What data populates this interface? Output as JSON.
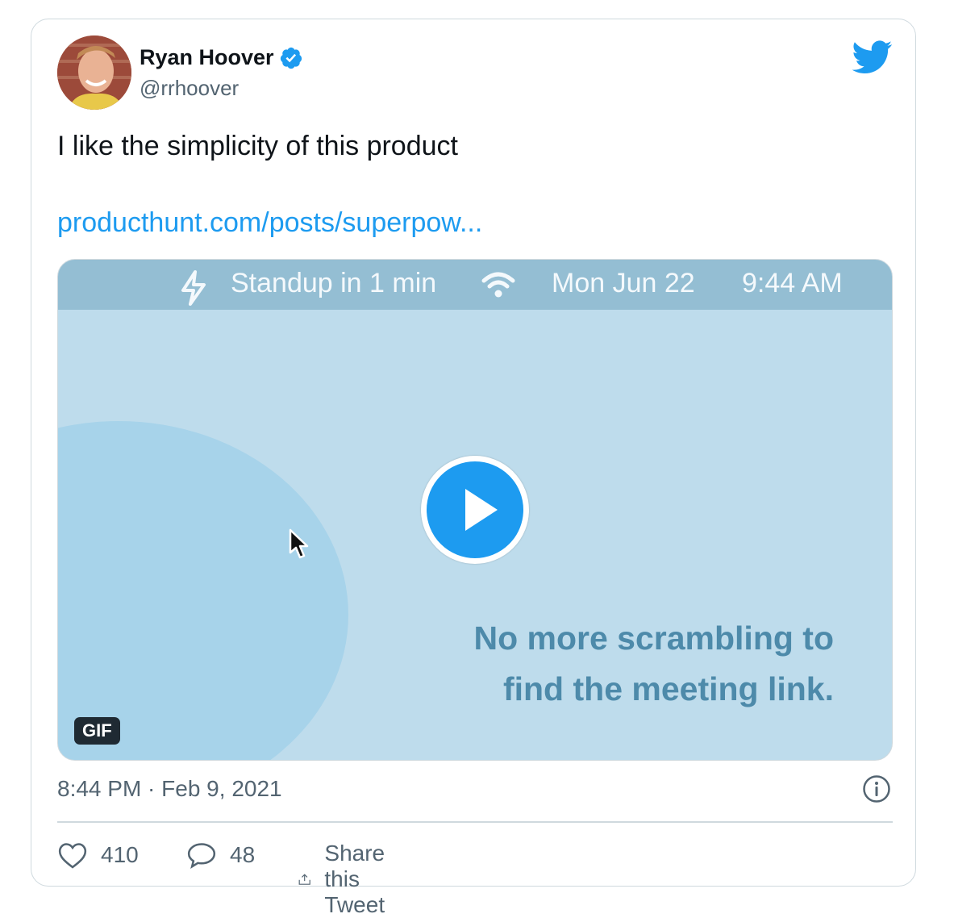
{
  "author": {
    "name": "Ryan Hoover",
    "handle": "@rrhoover",
    "verified": true
  },
  "tweet": {
    "text": "I like the simplicity of this product",
    "link_text": "producthunt.com/posts/superpow..."
  },
  "media": {
    "menubar": {
      "event_text": "Standup in 1 min",
      "date": "Mon Jun 22",
      "time": "9:44 AM"
    },
    "caption_line1": "No more scrambling to",
    "caption_line2": "find the meeting link.",
    "badge": "GIF"
  },
  "meta": {
    "timestamp": "8:44 PM · Feb 9, 2021"
  },
  "actions": {
    "likes": "410",
    "replies": "48",
    "share_label": "Share this Tweet"
  },
  "colors": {
    "accent": "#1d9bf0",
    "text_secondary": "#536471",
    "media_bg": "#bedcec",
    "caption": "#4d8aaa"
  }
}
